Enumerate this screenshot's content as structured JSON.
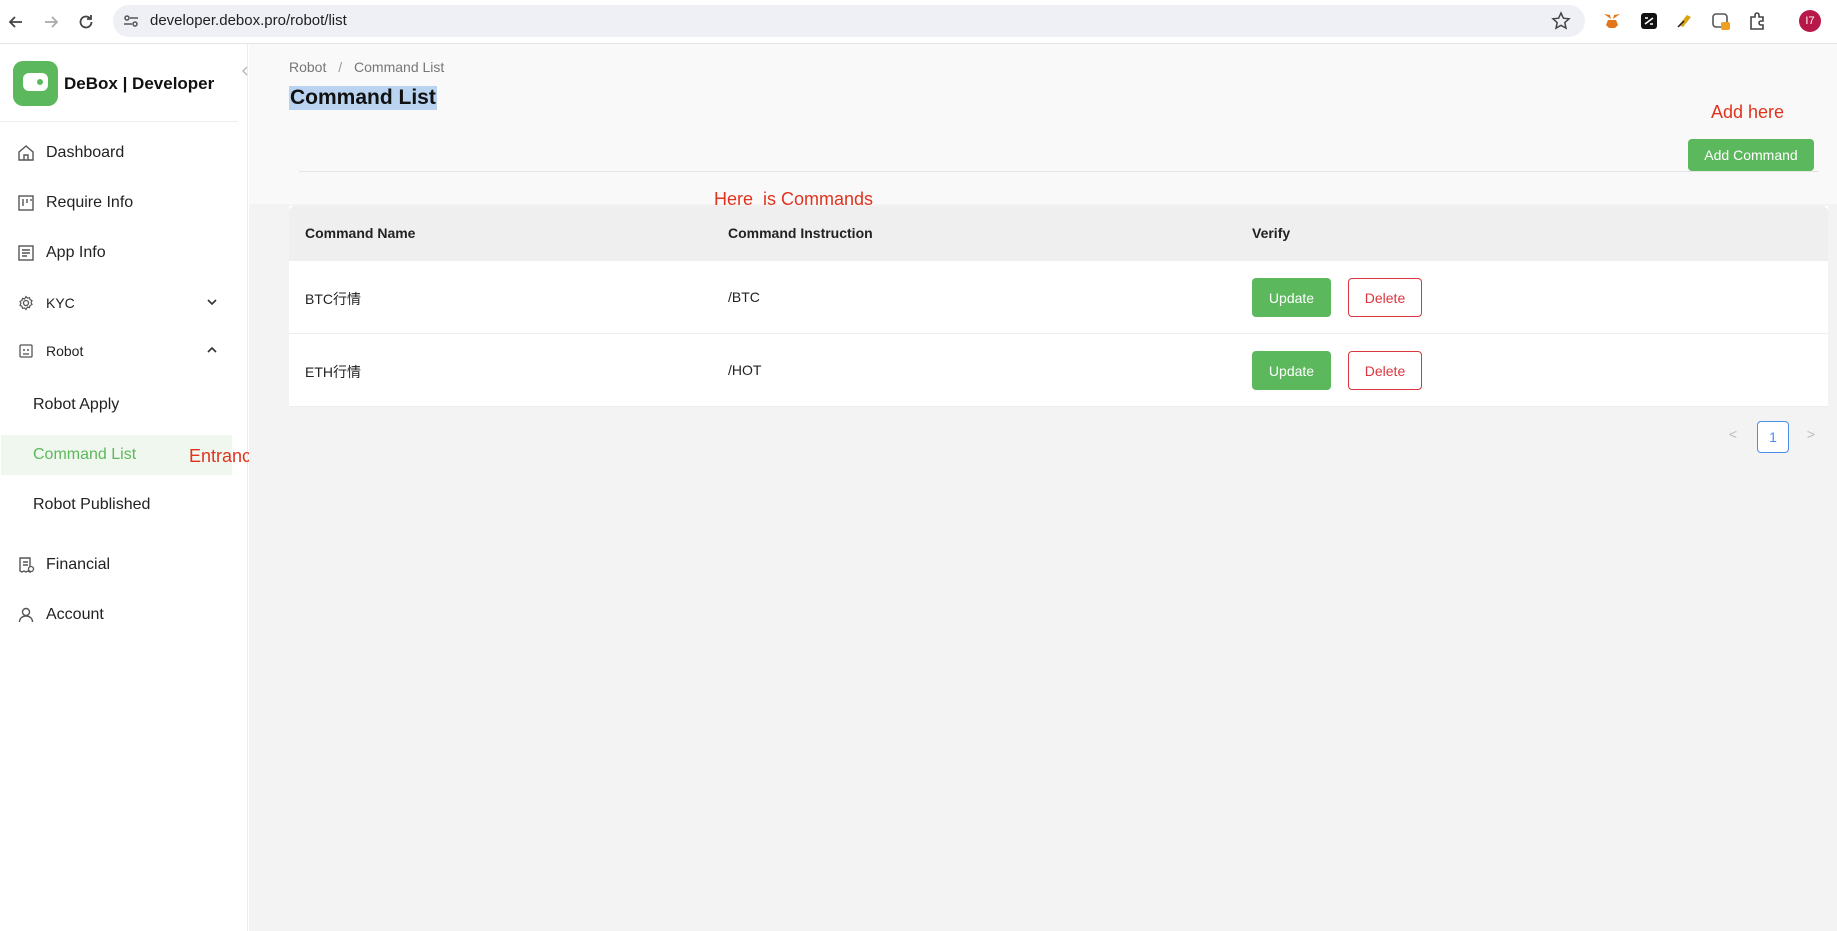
{
  "browser": {
    "url": "developer.debox.pro/robot/list",
    "profile_initial": "I7",
    "extension_badge": "1"
  },
  "sidebar": {
    "brand": "DeBox | Developer",
    "items": [
      {
        "label": "Dashboard",
        "icon": "home-icon"
      },
      {
        "label": "Require Info",
        "icon": "board-icon"
      },
      {
        "label": "App Info",
        "icon": "list-icon"
      },
      {
        "label": "KYC",
        "icon": "gear-icon"
      },
      {
        "label": "Robot",
        "icon": "robot-icon"
      },
      {
        "label": "Financial",
        "icon": "receipt-icon"
      },
      {
        "label": "Account",
        "icon": "user-icon"
      }
    ],
    "robot_sub": [
      {
        "label": "Robot Apply"
      },
      {
        "label": "Command List"
      },
      {
        "label": "Robot Published"
      }
    ]
  },
  "main": {
    "breadcrumb": [
      "Robot",
      "Command List"
    ],
    "title": "Command List",
    "add_button": "Add Command",
    "table": {
      "headers": [
        "Command Name",
        "Command Instruction",
        "Verify"
      ],
      "rows": [
        {
          "name": "BTC行情",
          "instruction": "/BTC"
        },
        {
          "name": "ETH行情",
          "instruction": "/HOT"
        }
      ],
      "update_label": "Update",
      "delete_label": "Delete"
    },
    "pagination": {
      "current": "1",
      "prev": "<",
      "next": ">"
    }
  },
  "annotations": {
    "add_here": "Add here",
    "here_is_commands": "Here  is Commands",
    "entrance": "Entrance"
  },
  "colors": {
    "accent_green": "#5cb85c",
    "danger": "#d9363e",
    "annotation_red": "#e0331e",
    "page_link_blue": "#4a8fe6"
  }
}
